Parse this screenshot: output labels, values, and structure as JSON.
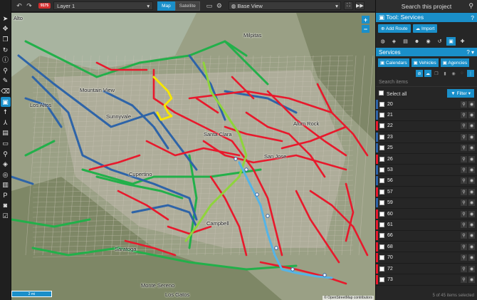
{
  "toolbar": {
    "tools": [
      {
        "name": "select-arrow-icon",
        "glyph": "➤"
      },
      {
        "name": "move-icon",
        "glyph": "✥"
      },
      {
        "name": "copy-icon",
        "glyph": "❐"
      },
      {
        "name": "rotate-icon",
        "glyph": "↻"
      },
      {
        "name": "info-icon",
        "glyph": "ⓘ"
      },
      {
        "name": "pin-icon",
        "glyph": "⚲"
      },
      {
        "name": "pen-icon",
        "glyph": "✎"
      },
      {
        "name": "eraser-icon",
        "glyph": "⌫"
      },
      {
        "name": "bus-icon",
        "glyph": "▣"
      },
      {
        "name": "person-icon",
        "glyph": "☨"
      },
      {
        "name": "split-icon",
        "glyph": "⅄"
      },
      {
        "name": "comment-icon",
        "glyph": "▤"
      },
      {
        "name": "ruler-icon",
        "glyph": "▭"
      },
      {
        "name": "search-icon",
        "glyph": "⚲"
      },
      {
        "name": "box-icon",
        "glyph": "◈"
      },
      {
        "name": "globe-icon",
        "glyph": "◎"
      },
      {
        "name": "chart-icon",
        "glyph": "▥"
      },
      {
        "name": "parking-icon",
        "glyph": "P"
      },
      {
        "name": "camera-icon",
        "glyph": "◙"
      },
      {
        "name": "check-icon",
        "glyph": "☑"
      }
    ]
  },
  "topbar": {
    "undo": "↶",
    "redo": "↷",
    "version_badge": "9175",
    "layer": "Layer 1",
    "map_tab": "Map",
    "satellite_tab": "Satellite",
    "basemap": "Base View",
    "dropdown_arrow": "▾"
  },
  "map": {
    "places": [
      {
        "text": "Alto"
      },
      {
        "text": "Milpitas"
      },
      {
        "text": "Mountain View"
      },
      {
        "text": "Los Altos"
      },
      {
        "text": "Sunnyvale"
      },
      {
        "text": "Santa Clara"
      },
      {
        "text": "San Jose"
      },
      {
        "text": "Cupertino"
      },
      {
        "text": "Campbell"
      },
      {
        "text": "Saratoga"
      },
      {
        "text": "Monte Sereno"
      },
      {
        "text": "Los Gatos"
      },
      {
        "text": "Alum Rock"
      }
    ],
    "scale_label": "2 mi",
    "attribution": "© OpenStreetMap contributors",
    "zoom_in": "+",
    "zoom_out": "−",
    "colors": {
      "red": "#e8192c",
      "blue": "#2e64a8",
      "green": "#22b04a",
      "yellow": "#f6e600",
      "lightgreen": "#8fd43c",
      "lightblue": "#55b4e6"
    }
  },
  "panel": {
    "search_title": "Search this project",
    "tool_title": "Tool: Services",
    "add_route": "Add Route",
    "import": "Import",
    "services_title": "Services",
    "tabs": [
      "Calendars",
      "Vehicles",
      "Agencies"
    ],
    "search_placeholder": "Search items",
    "select_all": "Select all",
    "filter": "Filter",
    "routes": [
      {
        "num": "20",
        "color": "#2e64a8"
      },
      {
        "num": "21",
        "color": "#2e64a8"
      },
      {
        "num": "22",
        "color": "#e8192c"
      },
      {
        "num": "23",
        "color": "#2e64a8"
      },
      {
        "num": "25",
        "color": "#2e64a8"
      },
      {
        "num": "26",
        "color": "#e8192c"
      },
      {
        "num": "53",
        "color": "#2e64a8"
      },
      {
        "num": "56",
        "color": "#2e64a8"
      },
      {
        "num": "57",
        "color": "#e8192c"
      },
      {
        "num": "59",
        "color": "#2e64a8"
      },
      {
        "num": "60",
        "color": "#e8192c"
      },
      {
        "num": "61",
        "color": "#e8192c"
      },
      {
        "num": "66",
        "color": "#e8192c"
      },
      {
        "num": "68",
        "color": "#e8192c"
      },
      {
        "num": "70",
        "color": "#e8192c"
      },
      {
        "num": "72",
        "color": "#e8192c"
      },
      {
        "num": "73",
        "color": "#e8192c"
      }
    ],
    "footer": "5 of 45 items selected"
  }
}
